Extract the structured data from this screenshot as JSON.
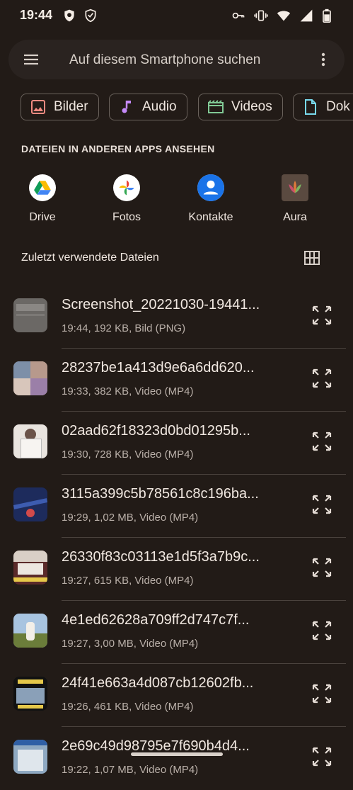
{
  "status": {
    "time": "19:44"
  },
  "search": {
    "placeholder": "Auf diesem Smartphone suchen"
  },
  "chips": [
    {
      "label": "Bilder",
      "icon": "image-icon",
      "color": "#f28b82"
    },
    {
      "label": "Audio",
      "icon": "music-note-icon",
      "color": "#c58af9"
    },
    {
      "label": "Videos",
      "icon": "movie-icon",
      "color": "#81c995"
    },
    {
      "label": "Dok",
      "icon": "document-icon",
      "color": "#78d9ec"
    }
  ],
  "apps_section": {
    "title": "DATEIEN IN ANDEREN APPS ANSEHEN"
  },
  "apps": [
    {
      "label": "Drive",
      "icon": "google-drive-icon"
    },
    {
      "label": "Fotos",
      "icon": "google-photos-icon"
    },
    {
      "label": "Kontakte",
      "icon": "contacts-icon"
    },
    {
      "label": "Aura",
      "icon": "aura-app-icon"
    }
  ],
  "recent": {
    "title": "Zuletzt verwendete Dateien"
  },
  "files": [
    {
      "name": "Screenshot_20221030-19441...",
      "meta": "19:44, 192 KB, Bild (PNG)"
    },
    {
      "name": "28237be1a413d9e6a6dd620...",
      "meta": "19:33, 382 KB, Video (MP4)"
    },
    {
      "name": "02aad62f18323d0bd01295b...",
      "meta": "19:30, 728 KB, Video (MP4)"
    },
    {
      "name": "3115a399c5b78561c8c196ba...",
      "meta": "19:29, 1,02 MB, Video (MP4)"
    },
    {
      "name": "26330f83c03113e1d5f3a7b9c...",
      "meta": "19:27, 615 KB, Video (MP4)"
    },
    {
      "name": "4e1ed62628a709ff2d747c7f...",
      "meta": "19:27, 3,00 MB, Video (MP4)"
    },
    {
      "name": "24f41e663a4d087cb12602fb...",
      "meta": "19:26, 461 KB, Video (MP4)"
    },
    {
      "name": "2e69c49d98795e7f690b4d4...",
      "meta": "19:22, 1,07 MB, Video (MP4)"
    }
  ],
  "colors": {
    "background": "#221b17",
    "accent_text": "#efe6df"
  }
}
